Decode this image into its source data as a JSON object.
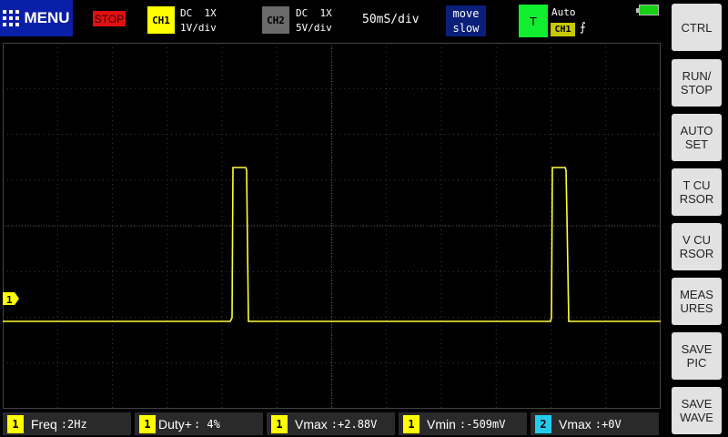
{
  "top_bar": {
    "menu_label": "MENU",
    "run_state": "STOP",
    "ch1": {
      "tag": "CH1",
      "coupling": "DC  1X",
      "scale": "1V/div"
    },
    "ch2": {
      "tag": "CH2",
      "coupling": "DC  1X",
      "scale": "5V/div"
    },
    "timebase": "50mS/div",
    "move": {
      "line1": "move",
      "line2": "slow"
    },
    "trigger": {
      "label": "T",
      "mode": "Auto",
      "source": "CH1",
      "edge": "⨍"
    }
  },
  "scope": {
    "ch1_marker": "1",
    "trace_color": "#ffff33",
    "grid_color": "#3a3a3a"
  },
  "side_buttons": [
    {
      "label": "CTRL"
    },
    {
      "label": "RUN/\nSTOP"
    },
    {
      "label": "AUTO\nSET"
    },
    {
      "label": "T CU\nRSOR"
    },
    {
      "label": "V CU\nRSOR"
    },
    {
      "label": "MEAS\nURES"
    },
    {
      "label": "SAVE\nPIC"
    },
    {
      "label": "SAVE\nWAVE"
    }
  ],
  "measurements": [
    {
      "channel": "1",
      "name": "Freq",
      "value": ":2Hz"
    },
    {
      "channel": "1",
      "name": "Duty+",
      "value": ": 4%"
    },
    {
      "channel": "1",
      "name": "Vmax",
      "value": ":+2.88V"
    },
    {
      "channel": "1",
      "name": "Vmin",
      "value": ":-509mV"
    },
    {
      "channel": "2",
      "name": "Vmax",
      "value": ":+0V"
    }
  ]
}
